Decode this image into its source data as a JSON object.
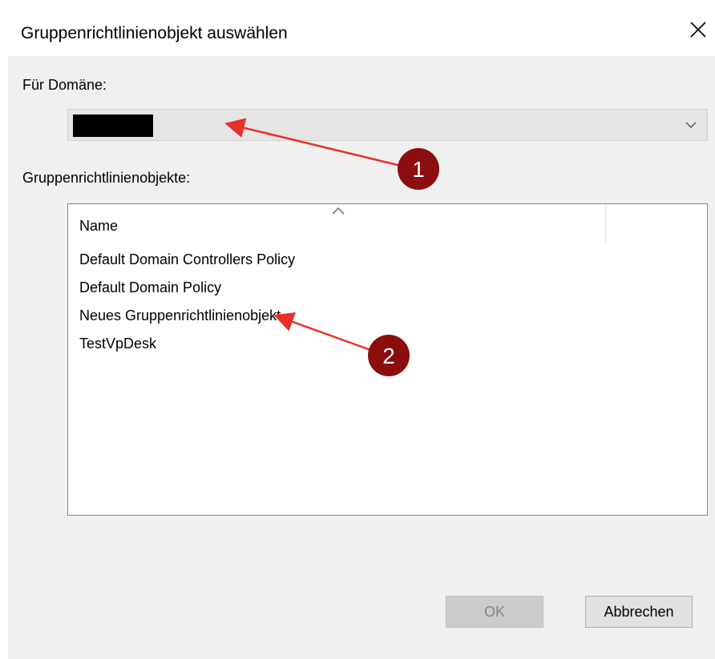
{
  "dialog": {
    "title": "Gruppenrichtlinienobjekt auswählen"
  },
  "domain_section": {
    "label": "Für Domäne:",
    "selected_value": "[redacted]"
  },
  "gpo_section": {
    "label": "Gruppenrichtlinienobjekte:",
    "column_header": "Name",
    "items": [
      "Default Domain Controllers Policy",
      "Default Domain Policy",
      "Neues Gruppenrichtlinienobjekt",
      "TestVpDesk"
    ]
  },
  "buttons": {
    "ok": "OK",
    "cancel": "Abbrechen"
  },
  "annotations": {
    "marker_1": "1",
    "marker_2": "2"
  },
  "colors": {
    "annotation_arrow": "#e8302a",
    "annotation_badge": "#8b0d0d",
    "client_background": "#f0f0f0"
  },
  "icons": {
    "close": "close-icon",
    "dropdown": "chevron-down-icon",
    "sort": "sort-ascending-icon"
  }
}
